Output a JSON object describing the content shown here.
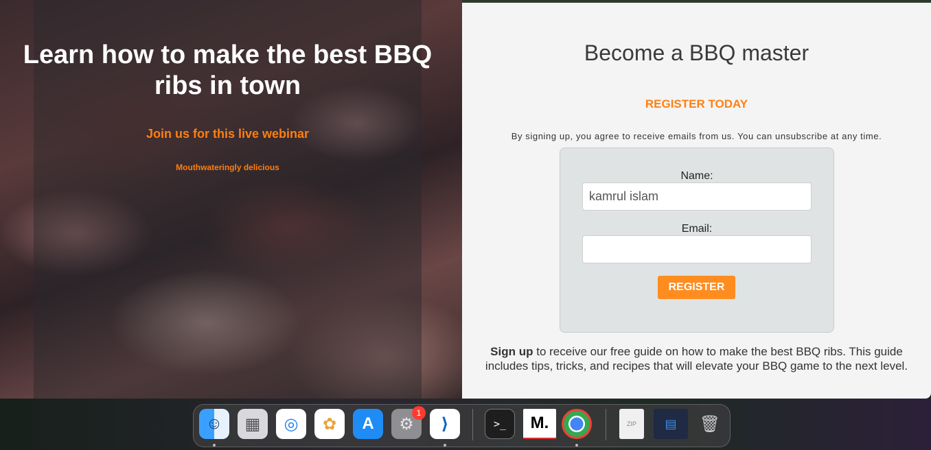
{
  "hero": {
    "title_part1": "Learn how to make ",
    "title_bold": "the best BBQ ribs",
    "title_part2": " in town",
    "subtitle": "Join us for this live webinar",
    "tagline": "Mouthwateringly delicious"
  },
  "signup": {
    "heading": "Become a BBQ master",
    "register_today": "REGISTER TODAY",
    "disclaimer": "By signing up, you agree to receive emails from us. You can unsubscribe at any time.",
    "name_label": "Name:",
    "name_value": "kamrul islam",
    "email_label": "Email:",
    "email_value": "",
    "button_label": "REGISTER",
    "body_bold": "Sign up",
    "body_text": " to receive our free guide on how to make the best BBQ ribs. This guide includes tips, tricks, and recipes that will elevate your BBQ game to the next level."
  },
  "dock": {
    "items": [
      {
        "name": "finder-icon",
        "glyph": "☺"
      },
      {
        "name": "launchpad-icon",
        "glyph": "▦"
      },
      {
        "name": "safari-icon",
        "glyph": "◎"
      },
      {
        "name": "photos-icon",
        "glyph": "✿"
      },
      {
        "name": "app-store-icon",
        "glyph": "A"
      },
      {
        "name": "system-settings-icon",
        "glyph": "⚙"
      },
      {
        "name": "vscode-icon",
        "glyph": "⟩"
      },
      {
        "name": "terminal-icon",
        "glyph": ">_"
      },
      {
        "name": "medium-icon",
        "glyph": "M."
      },
      {
        "name": "chrome-icon",
        "glyph": "◉"
      },
      {
        "name": "zip-file-icon",
        "glyph": "ZIP"
      },
      {
        "name": "vscode-window-thumbnail-icon",
        "glyph": "▤"
      },
      {
        "name": "trash-icon",
        "glyph": "🗑"
      }
    ],
    "settings_badge": "1"
  },
  "colors": {
    "accent": "#ff7f11",
    "button": "#ff8c1f",
    "panel_bg": "#f4f4f4",
    "form_bg": "#dfe3e3"
  }
}
